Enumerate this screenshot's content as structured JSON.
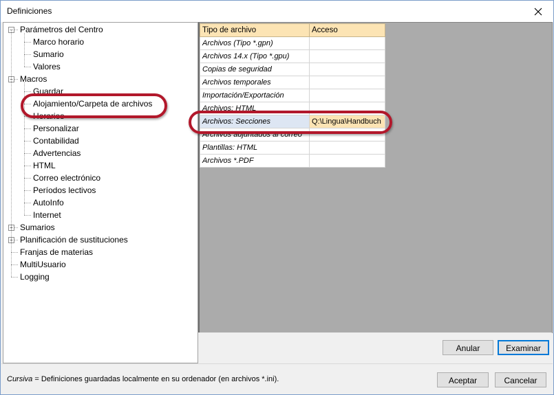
{
  "window": {
    "title": "Definiciones"
  },
  "tree": {
    "items": [
      {
        "label": "Parámetros del Centro",
        "level": 0,
        "expander": "−"
      },
      {
        "label": "Marco horario",
        "level": 1
      },
      {
        "label": "Sumario",
        "level": 1
      },
      {
        "label": "Valores",
        "level": 1
      },
      {
        "label": "Macros",
        "level": 0,
        "expander": "−"
      },
      {
        "label": "Guardar",
        "level": 1
      },
      {
        "label": "Alojamiento/Carpeta de archivos",
        "level": 1,
        "selected": true
      },
      {
        "label": "Horarios",
        "level": 1
      },
      {
        "label": "Personalizar",
        "level": 1
      },
      {
        "label": "Contabilidad",
        "level": 1
      },
      {
        "label": "Advertencias",
        "level": 1
      },
      {
        "label": "HTML",
        "level": 1
      },
      {
        "label": "Correo electrónico",
        "level": 1
      },
      {
        "label": "Períodos lectivos",
        "level": 1
      },
      {
        "label": "AutoInfo",
        "level": 1
      },
      {
        "label": "Internet",
        "level": 1
      },
      {
        "label": "Sumarios",
        "level": 0,
        "expander": "+"
      },
      {
        "label": "Planificación de sustituciones",
        "level": 0,
        "expander": "+"
      },
      {
        "label": "Franjas de materias",
        "level": 0
      },
      {
        "label": "MultiUsuario",
        "level": 0
      },
      {
        "label": "Logging",
        "level": 0
      }
    ]
  },
  "grid": {
    "headers": {
      "type": "Tipo de archivo",
      "access": "Acceso"
    },
    "rows": [
      {
        "type": "Archivos (Tipo *.gpn)",
        "access": ""
      },
      {
        "type": "Archivos 14.x (Tipo *.gpu)",
        "access": ""
      },
      {
        "type": "Copias de seguridad",
        "access": ""
      },
      {
        "type": "Archivos temporales",
        "access": ""
      },
      {
        "type": "Importación/Exportación",
        "access": ""
      },
      {
        "type": "Archivos: HTML",
        "access": ""
      },
      {
        "type": "Archivos: Secciones",
        "access": "Q:\\Lingua\\Handbuch",
        "selected": true
      },
      {
        "type": "Archivos adjuntados al correo",
        "access": ""
      },
      {
        "type": "Plantillas: HTML",
        "access": ""
      },
      {
        "type": "Archivos *.PDF",
        "access": ""
      }
    ]
  },
  "buttons": {
    "cancel_edit": "Anular",
    "browse": "Examinar",
    "ok": "Aceptar",
    "cancel": "Cancelar"
  },
  "footer": {
    "italic_word": "Cursiva",
    "note_rest": " = Definiciones guardadas localmente en su ordenador (en archivos *.ini)."
  },
  "icons": {
    "close": "close-icon",
    "tree_expander": "tree-expander-icon"
  },
  "colors": {
    "header_bg": "#fce4b4",
    "highlight": "#b2182b",
    "selected_row": "#dde6f3"
  }
}
